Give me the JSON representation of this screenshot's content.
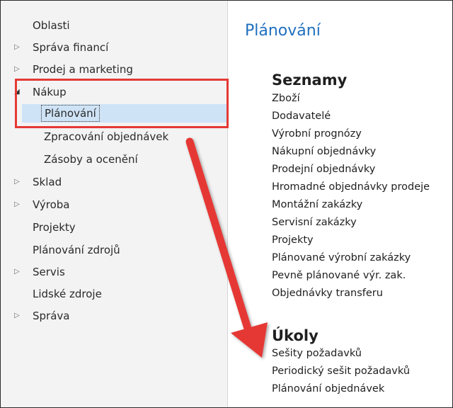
{
  "sidebar": {
    "items": [
      {
        "label": "Oblasti",
        "arrow": ""
      },
      {
        "label": "Správa financí",
        "arrow": "▷"
      },
      {
        "label": "Prodej a marketing",
        "arrow": "▷"
      },
      {
        "label": "Nákup",
        "arrow": "◢"
      },
      {
        "label": "Plánování",
        "arrow": ""
      },
      {
        "label": "Zpracování objednávek",
        "arrow": ""
      },
      {
        "label": "Zásoby a ocenění",
        "arrow": ""
      },
      {
        "label": "Sklad",
        "arrow": "▷"
      },
      {
        "label": "Výroba",
        "arrow": "▷"
      },
      {
        "label": "Projekty",
        "arrow": ""
      },
      {
        "label": "Plánování zdrojů",
        "arrow": ""
      },
      {
        "label": "Servis",
        "arrow": "▷"
      },
      {
        "label": "Lidské zdroje",
        "arrow": ""
      },
      {
        "label": "Správa",
        "arrow": "▷"
      }
    ]
  },
  "main": {
    "title": "Plánování",
    "lists": {
      "heading": "Seznamy",
      "items": [
        "Zboží",
        "Dodavatelé",
        "Výrobní prognózy",
        "Nákupní objednávky",
        "Prodejní objednávky",
        "Hromadné objednávky prodeje",
        "Montážní zakázky",
        "Servisní zakázky",
        "Projekty",
        "Plánované výrobní zakázky",
        "Pevně plánované výr. zak.",
        "Objednávky transferu"
      ]
    },
    "tasks": {
      "heading": "Úkoly",
      "items": [
        "Sešity požadavků",
        "Periodický sešit požadavků",
        "Plánování objednávek"
      ]
    }
  },
  "colors": {
    "accent": "#1f6fbf",
    "selection": "#cfe3f6",
    "annotation": "#e53935"
  }
}
